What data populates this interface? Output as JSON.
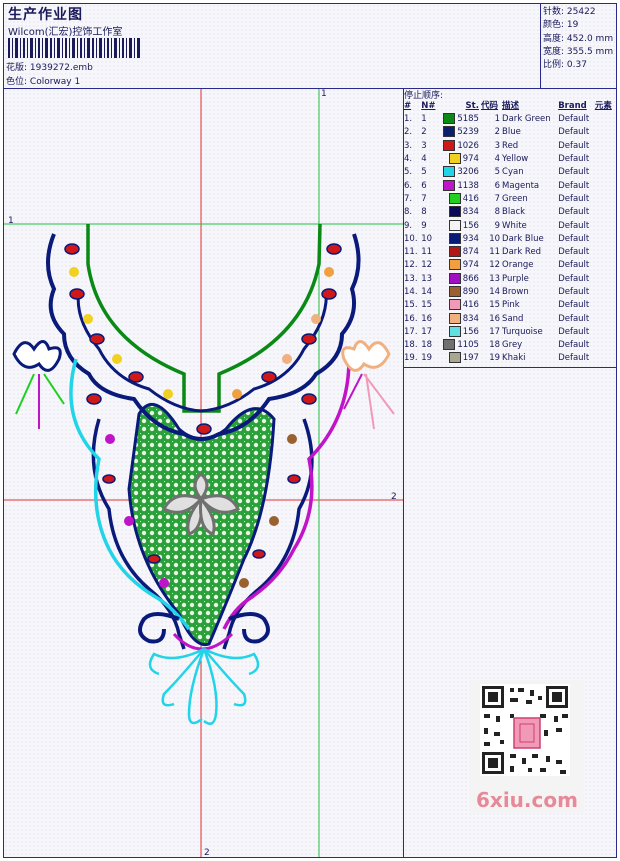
{
  "header": {
    "title": "生产作业图",
    "company": "Wilcom(汇宏)控饰工作室",
    "design_label": "花版:",
    "design_value": "1939272.emb",
    "colorway_label": "色位:",
    "colorway_value": "Colorway 1"
  },
  "stats": [
    {
      "label": "针数:",
      "value": "25422"
    },
    {
      "label": "颜色:",
      "value": "19"
    },
    {
      "label": "高度:",
      "value": "452.0 mm"
    },
    {
      "label": "宽度:",
      "value": "355.5 mm"
    },
    {
      "label": "比例:",
      "value": "0.37"
    }
  ],
  "stop_sequence": {
    "title": "停止顺序:",
    "headers": [
      "#",
      "N#",
      "St.",
      "代码",
      "描述",
      "Brand",
      "元素"
    ],
    "rows": [
      {
        "n": "1.",
        "nn": "1",
        "color": "#0a8a14",
        "st": "5185",
        "code": "1",
        "desc": "Dark Green",
        "brand": "Default"
      },
      {
        "n": "2.",
        "nn": "2",
        "color": "#0a1f6e",
        "st": "5239",
        "code": "2",
        "desc": "Blue",
        "brand": "Default"
      },
      {
        "n": "3.",
        "nn": "3",
        "color": "#d01818",
        "st": "1026",
        "code": "3",
        "desc": "Red",
        "brand": "Default"
      },
      {
        "n": "4.",
        "nn": "4",
        "color": "#f2d020",
        "st": "974",
        "code": "4",
        "desc": "Yellow",
        "brand": "Default"
      },
      {
        "n": "5.",
        "nn": "5",
        "color": "#22d4e8",
        "st": "3206",
        "code": "5",
        "desc": "Cyan",
        "brand": "Default"
      },
      {
        "n": "6.",
        "nn": "6",
        "color": "#c014c8",
        "st": "1138",
        "code": "6",
        "desc": "Magenta",
        "brand": "Default"
      },
      {
        "n": "7.",
        "nn": "7",
        "color": "#20d020",
        "st": "416",
        "code": "7",
        "desc": "Green",
        "brand": "Default"
      },
      {
        "n": "8.",
        "nn": "8",
        "color": "#0a0a5a",
        "st": "834",
        "code": "8",
        "desc": "Black",
        "brand": "Default"
      },
      {
        "n": "9.",
        "nn": "9",
        "color": "#f4f4f4",
        "st": "156",
        "code": "9",
        "desc": "White",
        "brand": "Default"
      },
      {
        "n": "10.",
        "nn": "10",
        "color": "#0a1a7a",
        "st": "934",
        "code": "10",
        "desc": "Dark Blue",
        "brand": "Default"
      },
      {
        "n": "11.",
        "nn": "11",
        "color": "#b01818",
        "st": "874",
        "code": "11",
        "desc": "Dark Red",
        "brand": "Default"
      },
      {
        "n": "12.",
        "nn": "12",
        "color": "#f0a040",
        "st": "974",
        "code": "12",
        "desc": "Orange",
        "brand": "Default"
      },
      {
        "n": "13.",
        "nn": "13",
        "color": "#a010c0",
        "st": "866",
        "code": "13",
        "desc": "Purple",
        "brand": "Default"
      },
      {
        "n": "14.",
        "nn": "14",
        "color": "#9a6030",
        "st": "890",
        "code": "14",
        "desc": "Brown",
        "brand": "Default"
      },
      {
        "n": "15.",
        "nn": "15",
        "color": "#f09ab8",
        "st": "416",
        "code": "15",
        "desc": "Pink",
        "brand": "Default"
      },
      {
        "n": "16.",
        "nn": "16",
        "color": "#f0b080",
        "st": "834",
        "code": "16",
        "desc": "Sand",
        "brand": "Default"
      },
      {
        "n": "17.",
        "nn": "17",
        "color": "#60e0e0",
        "st": "156",
        "code": "17",
        "desc": "Turquoise",
        "brand": "Default"
      },
      {
        "n": "18.",
        "nn": "18",
        "color": "#707070",
        "st": "1105",
        "code": "18",
        "desc": "Grey",
        "brand": "Default"
      },
      {
        "n": "19.",
        "nn": "19",
        "color": "#a8a890",
        "st": "197",
        "code": "19",
        "desc": "Khaki",
        "brand": "Default"
      }
    ]
  },
  "guides": {
    "v1": "1",
    "h1": "1",
    "h2": "2",
    "v2": "2"
  },
  "watermark": "6xiu.com",
  "colors": {
    "frame": "#2a2a8a",
    "guide_red": "#e03030",
    "guide_green": "#20c040"
  }
}
